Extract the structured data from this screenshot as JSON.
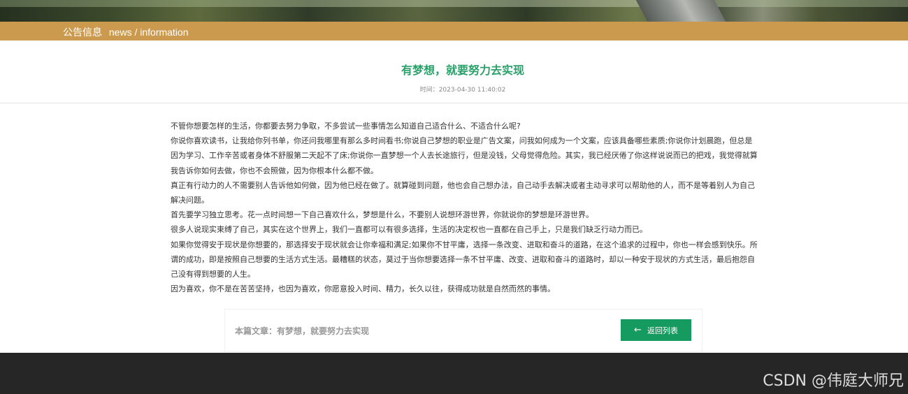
{
  "section": {
    "title_cn": "公告信息",
    "title_en": "news / information"
  },
  "article": {
    "title": "有梦想，就要努力去实现",
    "time": "时间：2023-04-30 11:40:02",
    "paragraphs": [
      "不管你想要怎样的生活，你都要去努力争取，不多尝试一些事情怎么知道自己适合什么、不适合什么呢?",
      "你说你喜欢读书，让我给你列书单，你还问我哪里有那么多时间看书;你说自己梦想的职业是广告文案，问我如何成为一个文案，应该具备哪些素质;你说你计划晨跑，但总是因为学习、工作辛苦或者身体不舒服第二天起不了床;你说你一直梦想一个人去长途旅行，但是没钱，父母觉得危险。其实，我已经厌倦了你这样说说而已的把戏，我觉得就算我告诉你如何去做，你也不会照做，因为你根本什么都不做。",
      "真正有行动力的人不需要别人告诉他如何做，因为他已经在做了。就算碰到问题，他也会自己想办法，自己动手去解决或者主动寻求可以帮助他的人，而不是等着别人为自己解决问题。",
      "首先要学习独立思考。花一点时间想一下自己喜欢什么，梦想是什么，不要别人说想环游世界，你就说你的梦想是环游世界。",
      "很多人说现实束缚了自己，其实在这个世界上，我们一直都可以有很多选择，生活的决定权也一直都在自己手上，只是我们缺乏行动力而已。",
      "如果你觉得安于现状是你想要的，那选择安于现状就会让你幸福和满足;如果你不甘平庸，选择一条改变、进取和奋斗的道路，在这个追求的过程中，你也一样会感到快乐。所谓的成功，即是按照自己想要的生活方式生活。最糟糕的状态，莫过于当你想要选择一条不甘平庸、改变、进取和奋斗的道路时，却以一种安于现状的方式生活，最后抱怨自己没有得到想要的人生。",
      "因为喜欢，你不是在苦苦坚持，也因为喜欢，你愿意投入时间、精力，长久以往，获得成功就是自然而然的事情。"
    ]
  },
  "footer_box": {
    "current_article": "本篇文章：有梦想，就要努力去实现",
    "back_button": "返回列表",
    "back_icon": "arrow-left-icon"
  },
  "watermark": "CSDN @伟庭大师兄",
  "colors": {
    "section_bar": "#cc9a4e",
    "title_green": "#2aa06a",
    "button_green": "#159a5f",
    "footer_dark": "#262626"
  }
}
